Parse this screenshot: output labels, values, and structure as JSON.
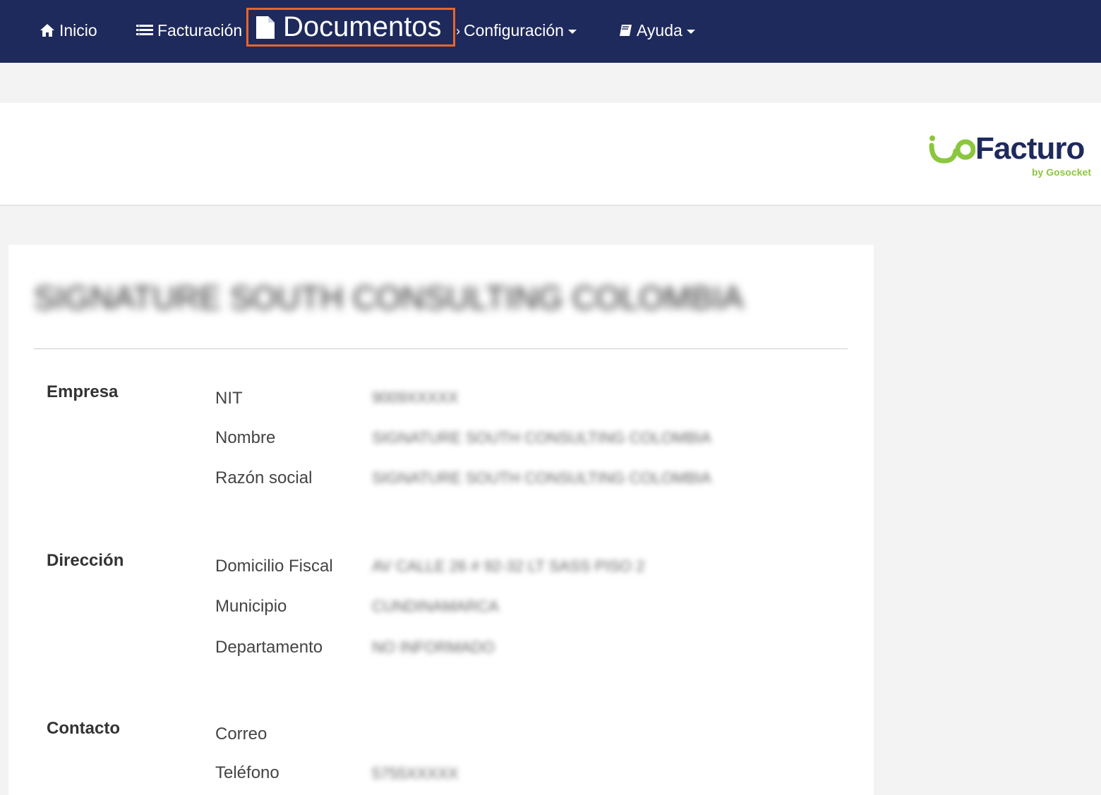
{
  "nav": {
    "inicio": "Inicio",
    "facturacion": "Facturación",
    "documentos": "Documentos",
    "separator": "›",
    "configuracion": "Configuración",
    "ayuda": "Ayuda"
  },
  "logo": {
    "word": "Facturo",
    "sub": "by Gosocket"
  },
  "colors": {
    "navbar": "#1e2a5c",
    "highlight": "#e8652a",
    "brand_green": "#8cc63f"
  },
  "company": {
    "title": "SIGNATURE SOUTH CONSULTING COLOMBIA"
  },
  "sections": {
    "empresa": {
      "label": "Empresa",
      "nit_label": "NIT",
      "nit_value": "9009XXXXX",
      "nombre_label": "Nombre",
      "nombre_value": "SIGNATURE SOUTH CONSULTING COLOMBIA",
      "razon_label": "Razón social",
      "razon_value": "SIGNATURE SOUTH CONSULTING COLOMBIA"
    },
    "direccion": {
      "label": "Dirección",
      "domicilio_label": "Domicilio Fiscal",
      "domicilio_value": "AV CALLE 26 # 92-32 LT SASS PISO 2",
      "municipio_label": "Municipio",
      "municipio_value": "CUNDINAMARCA",
      "departamento_label": "Departamento",
      "departamento_value": "NO INFORMADO"
    },
    "contacto": {
      "label": "Contacto",
      "correo_label": "Correo",
      "telefono_label": "Teléfono",
      "telefono_value": "5755XXXXX"
    }
  }
}
